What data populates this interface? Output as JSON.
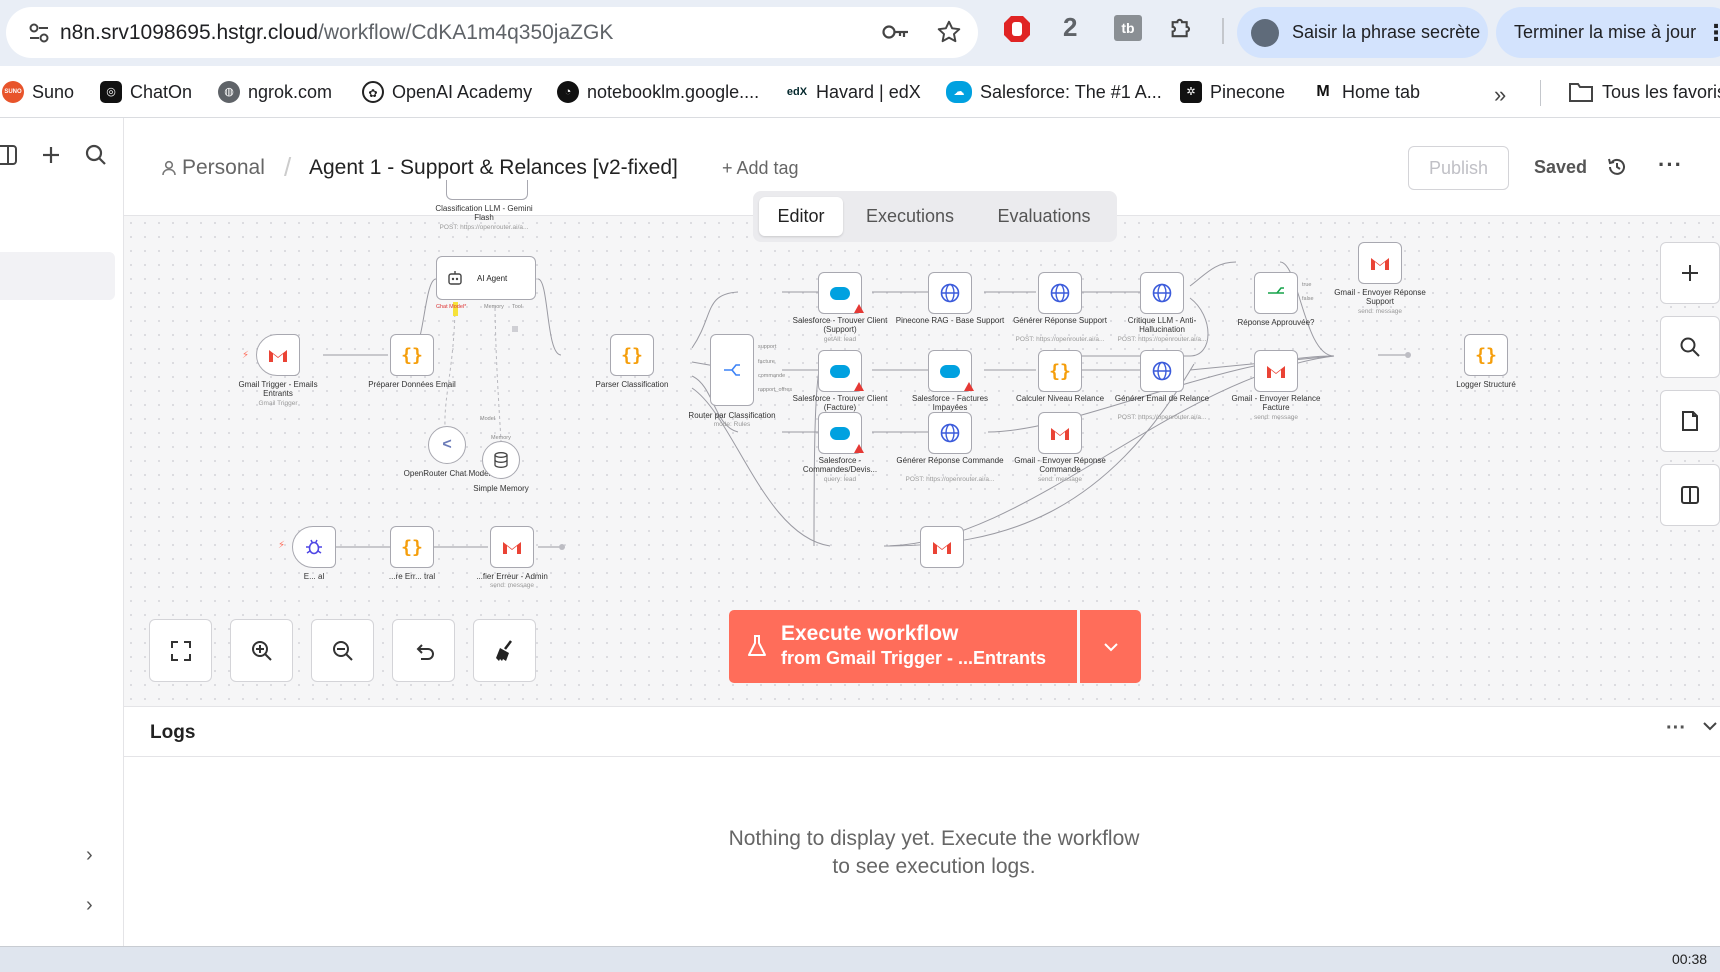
{
  "browser": {
    "url_host": "n8n.srv1098695.hstgr.cloud",
    "url_path": "/workflow/CdKA1m4q350jaZGK",
    "ext_badge": "2",
    "ext_tb": "tb",
    "profile_pill": "Saisir la phrase secrète",
    "update_pill": "Terminer la mise à jour"
  },
  "bookmarks": [
    {
      "label": "Suno",
      "icon": "suno-icon",
      "color": "#e8542b"
    },
    {
      "label": "ChatOn",
      "icon": "chaton-icon",
      "color": "#111111"
    },
    {
      "label": "ngrok.com",
      "icon": "globe-icon",
      "color": "#5f6368"
    },
    {
      "label": "OpenAI Academy",
      "icon": "openai-icon",
      "color": "#222222"
    },
    {
      "label": "notebooklm.google....",
      "icon": "notebooklm-icon",
      "color": "#111111"
    },
    {
      "label": "Havard | edX",
      "icon": "edx-icon",
      "color": "#02262b"
    },
    {
      "label": "Salesforce: The #1 A...",
      "icon": "salesforce-icon",
      "color": "#00a1e0"
    },
    {
      "label": "Pinecone",
      "icon": "pinecone-icon",
      "color": "#111111"
    },
    {
      "label": "Home tab",
      "icon": "m-icon",
      "color": "#111111"
    }
  ],
  "bookmarks_all": "Tous les favoris",
  "header": {
    "project": "Personal",
    "workflow_title": "Agent 1 - Support & Relances [v2-fixed]",
    "add_tag": "+ Add tag",
    "publish": "Publish",
    "saved": "Saved"
  },
  "tabs": [
    "Editor",
    "Executions",
    "Evaluations"
  ],
  "nodes": {
    "classification_llm": {
      "label": "Classification LLM - Gemini Flash",
      "sub": "POST: https://openrouter.ai/a..."
    },
    "ai_agent": {
      "label": "AI Agent",
      "port_chat": "Chat Model*",
      "port_memory": "Memory",
      "port_tool": "Tool"
    },
    "gmail_trigger": {
      "label": "Gmail Trigger - Emails Entrants",
      "sub": "Gmail Trigger"
    },
    "preparer": {
      "label": "Préparer Données Email"
    },
    "openrouter": {
      "label": "OpenRouter Chat Model",
      "port": "Model"
    },
    "memory": {
      "label": "Simple Memory",
      "port": "Memory"
    },
    "parser": {
      "label": "Parser Classification"
    },
    "router": {
      "label": "Router par Classification",
      "sub": "mode: Rules",
      "outs": [
        "support",
        "facture",
        "commande",
        "rapport_offres"
      ]
    },
    "sf_support": {
      "label": "Salesforce - Trouver Client (Support)",
      "sub": "getAll: lead"
    },
    "pinecone": {
      "label": "Pinecone RAG - Base Support"
    },
    "gen_support": {
      "label": "Générer Réponse Support",
      "sub": "POST: https://openrouter.ai/a..."
    },
    "critique": {
      "label": "Critique LLM - Anti-Hallucination",
      "sub": "POST: https://openrouter.ai/a..."
    },
    "reponse_ok": {
      "label": "Réponse Approuvée?",
      "outs": [
        "true",
        "false"
      ]
    },
    "gmail_support": {
      "label": "Gmail - Envoyer Réponse Support",
      "sub": "send: message"
    },
    "sf_facture": {
      "label": "Salesforce - Trouver Client (Facture)",
      "sub": "getAll: lead"
    },
    "sf_impayees": {
      "label": "Salesforce - Factures Impayées"
    },
    "calc_relance": {
      "label": "Calculer Niveau Relance"
    },
    "gen_relance": {
      "label": "Générer Email de Relance",
      "sub": "POST: https://openrouter.ai/a..."
    },
    "gmail_relance": {
      "label": "Gmail - Envoyer Relance Facture",
      "sub": "send: message"
    },
    "sf_commandes": {
      "label": "Salesforce - Commandes/Devis...",
      "sub": "query: lead"
    },
    "gen_commande": {
      "label": "Générer Réponse Commande",
      "sub": "POST: https://openrouter.ai/a..."
    },
    "gmail_commande": {
      "label": "Gmail - Envoyer Réponse Commande",
      "sub": "send: message"
    },
    "logger": {
      "label": "Logger Structuré"
    },
    "err_trigger": {
      "label": "E... al"
    },
    "err_format": {
      "label": "...re Err... tral"
    },
    "err_gmail": {
      "label": "...fier Erreur - Admin",
      "sub": "send: message"
    }
  },
  "execute": {
    "title": "Execute workflow",
    "subtitle": "from Gmail Trigger - ...Entrants"
  },
  "logs": {
    "title": "Logs",
    "empty": "Nothing to display yet. Execute the workflow to see execution logs."
  },
  "clock": "00:38",
  "colors": {
    "accent": "#ff6d5a",
    "braces": "#f59e0b",
    "salesforce": "#00a1e0",
    "globe": "#3b5bdb",
    "warn": "#e53935"
  }
}
